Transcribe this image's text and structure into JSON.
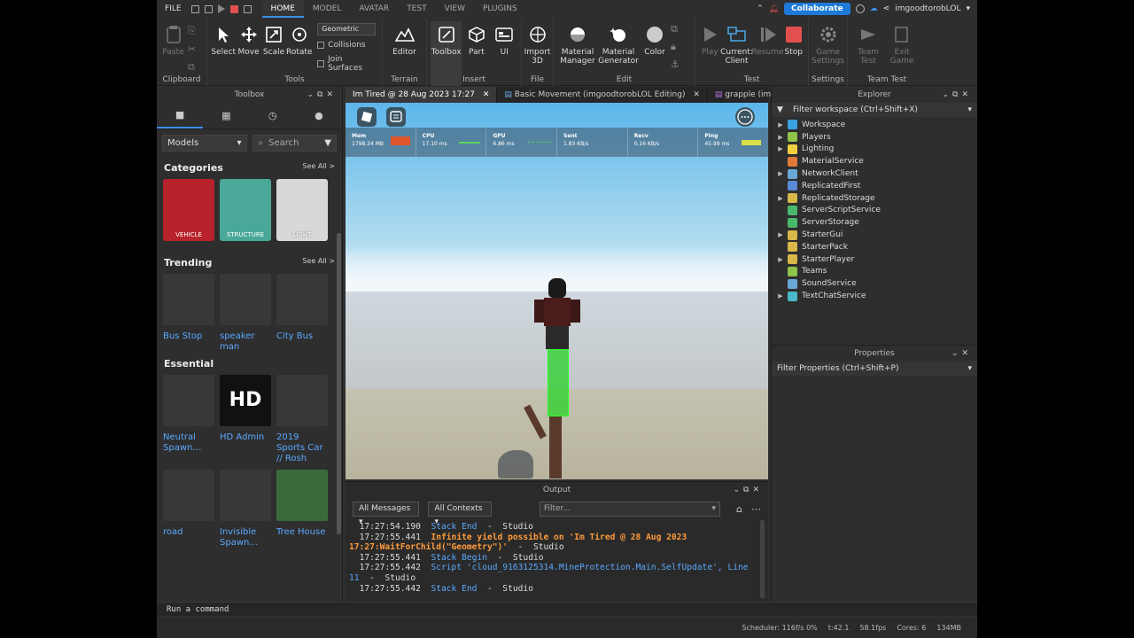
{
  "menubar": {
    "file": "FILE",
    "tabs": [
      "HOME",
      "MODEL",
      "AVATAR",
      "TEST",
      "VIEW",
      "PLUGINS"
    ],
    "active_tab": "HOME",
    "collaborate": "Collaborate",
    "username": "imgoodtorobLOL"
  },
  "ribbon": {
    "clipboard": {
      "label": "Clipboard",
      "paste": "Paste"
    },
    "tools": {
      "label": "Tools",
      "select": "Select",
      "move": "Move",
      "scale": "Scale",
      "rotate": "Rotate",
      "mode": "Geometric",
      "collisions": "Collisions",
      "join_surfaces": "Join Surfaces"
    },
    "terrain": {
      "label": "Terrain",
      "editor": "Editor"
    },
    "insert": {
      "label": "Insert",
      "toolbox": "Toolbox",
      "part": "Part",
      "ui": "UI"
    },
    "file": {
      "label": "File",
      "import3d": "Import 3D"
    },
    "edit": {
      "label": "Edit",
      "material_manager": "Material Manager",
      "material_generator": "Material Generator",
      "color": "Color"
    },
    "test": {
      "label": "Test",
      "play": "Play",
      "current_client": "Current: Client",
      "resume": "Resume",
      "stop": "Stop"
    },
    "settings": {
      "label": "Settings",
      "game_settings": "Game Settings"
    },
    "team_test": {
      "label": "Team Test",
      "team_test": "Team Test",
      "exit_game": "Exit Game"
    }
  },
  "toolbox": {
    "title": "Toolbox",
    "category_select": "Models",
    "search_placeholder": "Search",
    "categories_title": "Categories",
    "see_all": "See All >",
    "categories": [
      {
        "label": "VEHICLE",
        "color": "#b8232b"
      },
      {
        "label": "STRUCTURE",
        "color": "#4aa898"
      },
      {
        "label": "LIGHT",
        "color": "#d8d8d8"
      }
    ],
    "trending_title": "Trending",
    "trending": [
      "Bus Stop",
      "speaker man",
      "City Bus"
    ],
    "essential_title": "Essential",
    "essential": [
      "Neutral Spawn…",
      "HD Admin",
      "2019 Sports Car // Rosh"
    ],
    "more": [
      "road",
      "Invisible Spawn…",
      "Tree House"
    ],
    "hd_logo": "HD"
  },
  "viewport_tabs": [
    "Im Tired @ 28 Aug 2023 17:27",
    "Basic Movement (imgoodtorobLOL Editing)",
    "grapple (imgood"
  ],
  "perf": [
    {
      "name": "Mem",
      "value": "1798.34 MB"
    },
    {
      "name": "CPU",
      "value": "17.10 ms"
    },
    {
      "name": "GPU",
      "value": "6.86 ms"
    },
    {
      "name": "Sent",
      "value": "1.83 KB/s"
    },
    {
      "name": "Recv",
      "value": "0.16 KB/s"
    },
    {
      "name": "Ping",
      "value": "45.99 ms"
    }
  ],
  "output": {
    "title": "Output",
    "messages_filter": "All Messages",
    "contexts_filter": "All Contexts",
    "filter_placeholder": "Filter...",
    "lines": [
      {
        "time": "  17:27:54.190  ",
        "msg": "Stack End",
        "rest": "  -  Studio",
        "kind": "stk"
      },
      {
        "time": "  17:27:55.441  ",
        "msg": "Infinite yield possible on 'Im Tired @ 28 Aug 2023 17:27:WaitForChild(\"Geometry\")'",
        "rest": "  -  Studio",
        "kind": "warn"
      },
      {
        "time": "  17:27:55.441  ",
        "msg": "Stack Begin",
        "rest": "  -  Studio",
        "kind": "stk"
      },
      {
        "time": "  17:27:55.442  ",
        "msg": "Script 'cloud_9163125314.MineProtection.Main.SelfUpdate', Line 11",
        "rest": "  -  Studio",
        "kind": "stk"
      },
      {
        "time": "  17:27:55.442  ",
        "msg": "Stack End",
        "rest": "  -  Studio",
        "kind": "stk"
      }
    ]
  },
  "command_bar": "Run a command",
  "status": [
    "Scheduler: 116f/s 0%",
    "t:42.1",
    "58.1fps",
    "Cores: 6",
    "134MB"
  ],
  "explorer": {
    "title": "Explorer",
    "filter": "Filter workspace (Ctrl+Shift+X)",
    "items": [
      {
        "name": "Workspace",
        "arrow": true,
        "color": "#3aa0e0"
      },
      {
        "name": "Players",
        "arrow": true,
        "color": "#8fc34a"
      },
      {
        "name": "Lighting",
        "arrow": true,
        "color": "#f0d040"
      },
      {
        "name": "MaterialService",
        "arrow": false,
        "color": "#e07a3a"
      },
      {
        "name": "NetworkClient",
        "arrow": true,
        "color": "#6aa8d8"
      },
      {
        "name": "ReplicatedFirst",
        "arrow": false,
        "color": "#5a8ad8"
      },
      {
        "name": "ReplicatedStorage",
        "arrow": true,
        "color": "#d8b84a"
      },
      {
        "name": "ServerScriptService",
        "arrow": false,
        "color": "#4ab86a"
      },
      {
        "name": "ServerStorage",
        "arrow": false,
        "color": "#4ab86a"
      },
      {
        "name": "StarterGui",
        "arrow": true,
        "color": "#d8b84a"
      },
      {
        "name": "StarterPack",
        "arrow": false,
        "color": "#d8b84a"
      },
      {
        "name": "StarterPlayer",
        "arrow": true,
        "color": "#d8b84a"
      },
      {
        "name": "Teams",
        "arrow": false,
        "color": "#8fc34a"
      },
      {
        "name": "SoundService",
        "arrow": false,
        "color": "#6aa8d8"
      },
      {
        "name": "TextChatService",
        "arrow": true,
        "color": "#4ab8c8"
      }
    ]
  },
  "properties": {
    "title": "Properties",
    "filter": "Filter Properties (Ctrl+Shift+P)"
  }
}
